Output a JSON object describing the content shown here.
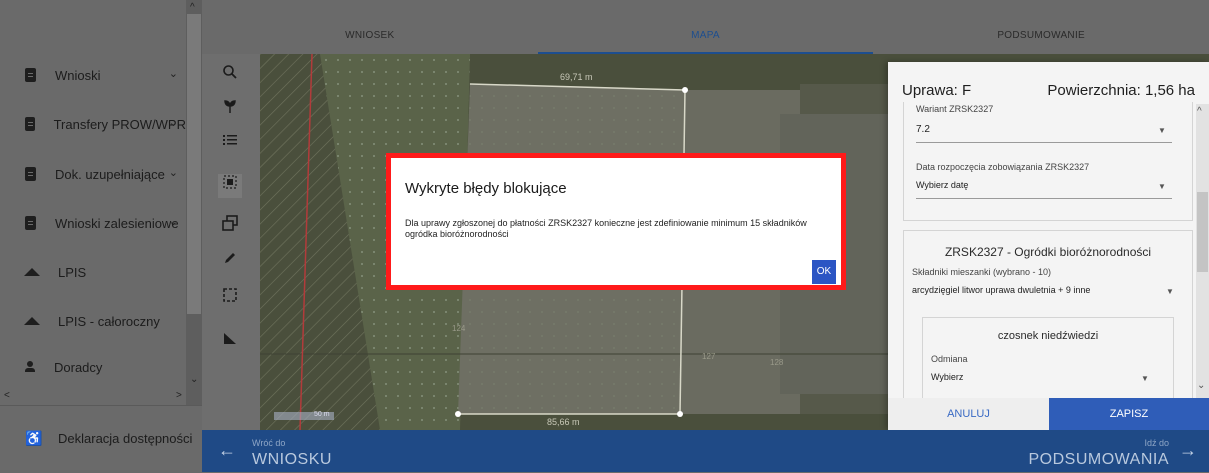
{
  "sidebar": {
    "items": [
      {
        "label": "Wnioski",
        "icon": "clipboard-icon",
        "has_chevron": true
      },
      {
        "label": "Transfery PROW/WPR",
        "icon": "clipboard-icon",
        "has_chevron": true
      },
      {
        "label": "Dok. uzupełniające",
        "icon": "clipboard-icon",
        "has_chevron": true
      },
      {
        "label": "Wnioski zalesieniowe",
        "icon": "clipboard-icon",
        "has_chevron": true
      },
      {
        "label": "LPIS",
        "icon": "terrain-icon",
        "has_chevron": false
      },
      {
        "label": "LPIS - całoroczny",
        "icon": "terrain-icon",
        "has_chevron": false
      },
      {
        "label": "Doradcy",
        "icon": "person-icon",
        "has_chevron": false
      }
    ],
    "bottom_item": {
      "label": "Deklaracja dostępności",
      "icon": "accessibility-icon"
    }
  },
  "tabs": [
    {
      "label": "WNIOSEK",
      "active": false
    },
    {
      "label": "MAPA",
      "active": true
    },
    {
      "label": "PODSUMOWANIE",
      "active": false
    }
  ],
  "tools": [
    "search-icon",
    "plant-icon",
    "list-icon",
    "select-icon",
    "layers-icon",
    "edit-icon",
    "crop-icon",
    "measure-icon"
  ],
  "map": {
    "labels": [
      "69,71 m",
      "85,66 m",
      "124",
      "127",
      "128",
      "50 m"
    ]
  },
  "panel": {
    "title": "Uprawa: F",
    "area": "Powierzchnia: 1,56 ha",
    "variant_label": "Wariant ZRSK2327",
    "variant_value": "7.2",
    "date_label": "Data rozpoczęcia zobowiązania ZRSK2327",
    "date_value": "Wybierz datę",
    "garden_title": "ZRSK2327 - Ogródki bioróżnorodności",
    "mix_label": "Składniki mieszanki (wybrano - 10)",
    "mix_value": "arcydzięgiel litwor uprawa dwuletnia + 9 inne",
    "sub_title": "czosnek niedźwiedzi",
    "sub_label": "Odmiana",
    "sub_value": "Wybierz",
    "cancel": "ANULUJ",
    "save": "ZAPISZ"
  },
  "bottom": {
    "back_small": "Wróć do",
    "back_big": "WNIOSKU",
    "next_small": "Idź do",
    "next_big": "PODSUMOWANIA"
  },
  "modal": {
    "title": "Wykryte błędy blokujące",
    "message": "Dla uprawy zgłoszonej do płatności ZRSK2327 konieczne jest zdefiniowanie minimum 15 składników ogródka bioróżnorodności",
    "ok": "OK"
  },
  "colors": {
    "accent": "#2f5db8",
    "bottom_bar": "#1f4a86",
    "highlight": "#ff1a1a"
  }
}
